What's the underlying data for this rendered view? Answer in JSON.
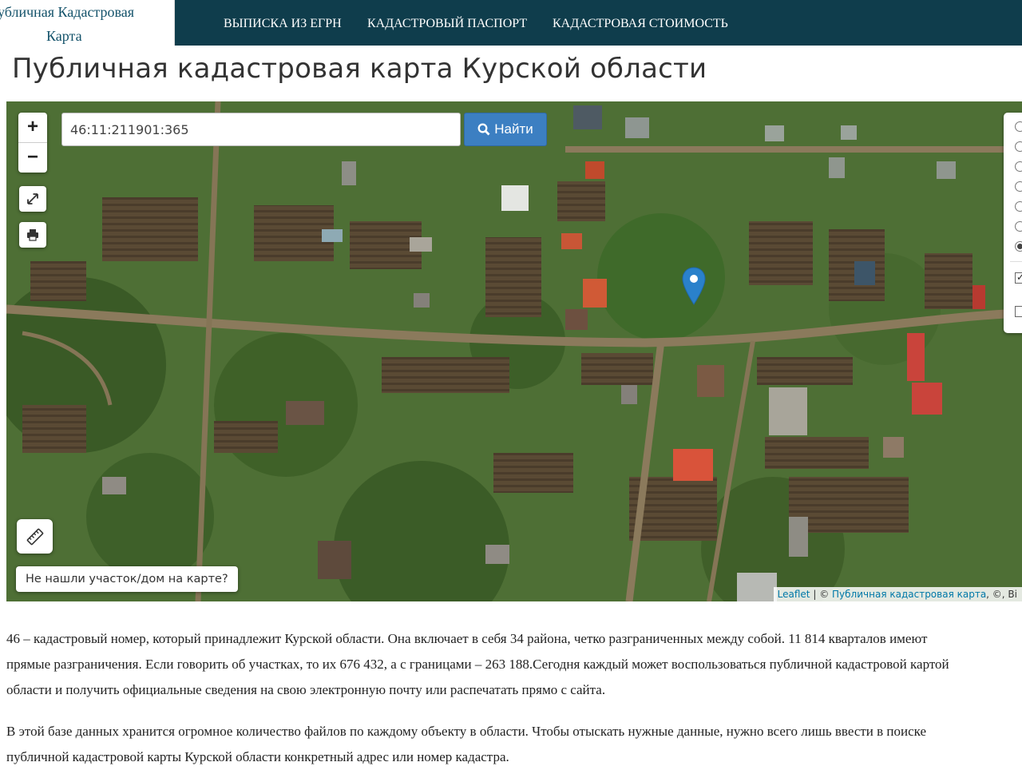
{
  "header": {
    "brand_line1": "Публичная Кадастровая",
    "brand_line2": "Карта",
    "nav": [
      {
        "label": "Выписка из ЕГРН"
      },
      {
        "label": "Кадастровый паспорт"
      },
      {
        "label": "Кадастровая стоимость"
      }
    ]
  },
  "page_title": "Публичная кадастровая карта Курской области",
  "map": {
    "search": {
      "value": "46:11:211901:365",
      "button_label": "Найти"
    },
    "zoom_in_label": "+",
    "zoom_out_label": "−",
    "not_found_label": "Не нашли участок/дом на карте?",
    "attribution": {
      "leaflet": "Leaflet",
      "sep": "|",
      "copy": "©",
      "cadastral": "Публичная кадастровая карта",
      "rest": ", ©, Bi"
    },
    "layers": {
      "base_selected_index": 6,
      "overlays_checked": [
        true,
        false
      ]
    }
  },
  "content": {
    "lines": [
      "46 – кадастровый номер, который принадлежит Курской области. Она включает в себя 34 района, четко разграниченных между собой. 11 814 кварталов имеют",
      "прямые разграничения. Если говорить об участках, то их 676 432, а с границами – 263 188.Сегодня каждый может воспользоваться публичной кадастровой картой",
      "области и получить официальные сведения на свою электронную почту или распечатать прямо с сайта.",
      "В этой базе данных хранится огромное количество файлов по каждому объекту в области. Чтобы отыскать нужные данные, нужно всего лишь ввести в поиске",
      "публичной кадастровой карты Курской области конкретный адрес или номер кадастра."
    ]
  },
  "colors": {
    "header_bg": "#0f3d4c",
    "brand_text": "#13526a",
    "search_button": "#3c7fc2",
    "marker": "#2a81cb",
    "link": "#0078a8"
  },
  "icons": [
    "search-icon",
    "fullscreen-icon",
    "print-icon",
    "ruler-icon",
    "map-marker-icon"
  ]
}
